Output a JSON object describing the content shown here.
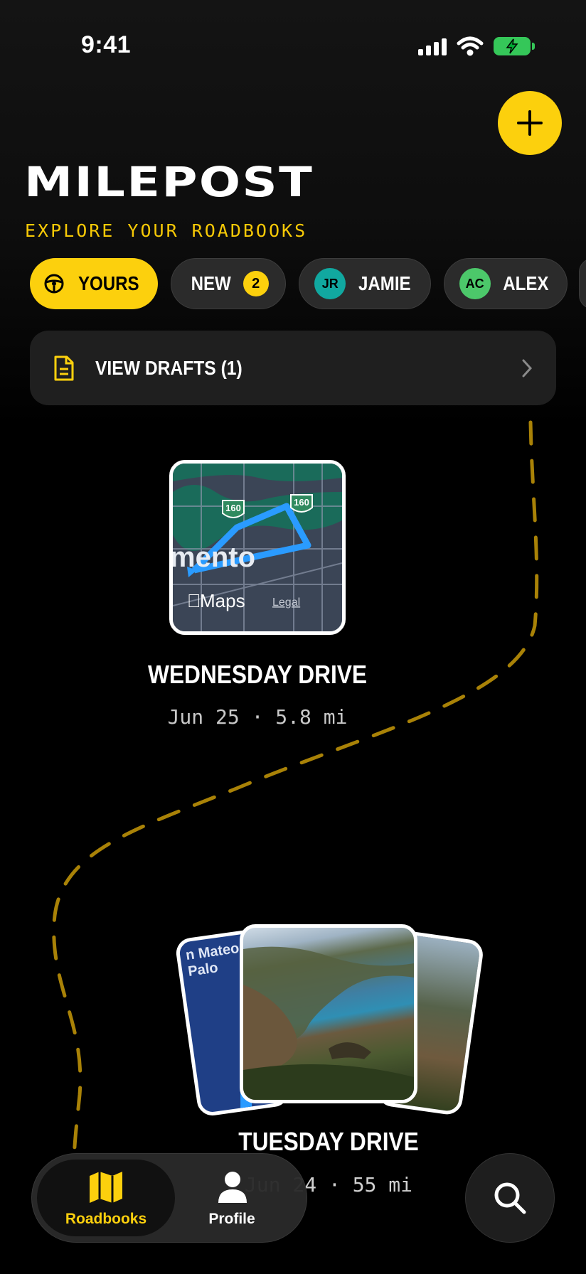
{
  "status_bar": {
    "time": "9:41"
  },
  "header": {
    "brand": "MILEPOST",
    "subtitle": "EXPLORE YOUR ROADBOOKS"
  },
  "filters": [
    {
      "label": "YOURS",
      "active": true,
      "icon": "steering-wheel-icon"
    },
    {
      "label": "NEW",
      "badge": "2"
    },
    {
      "label": "JAMIE",
      "initials": "JR"
    },
    {
      "label": "ALEX",
      "initials": "AC"
    }
  ],
  "drafts": {
    "label": "VIEW DRAFTS (1)"
  },
  "roadbooks": [
    {
      "title": "WEDNESDAY DRIVE",
      "meta": "Jun 25 · 5.8 mi",
      "map_labels": {
        "route_shield": "160",
        "city_fragment": "mento",
        "maps_brand": "Maps",
        "legal": "Legal"
      }
    },
    {
      "title": "TUESDAY DRIVE",
      "meta": "Jun 24 · 55 mi",
      "map_fragment": "n Mateo\nPalo"
    }
  ],
  "tabs": [
    {
      "label": "Roadbooks",
      "active": true
    },
    {
      "label": "Profile",
      "active": false
    }
  ],
  "colors": {
    "accent": "#fcd00d",
    "background": "#000000"
  }
}
